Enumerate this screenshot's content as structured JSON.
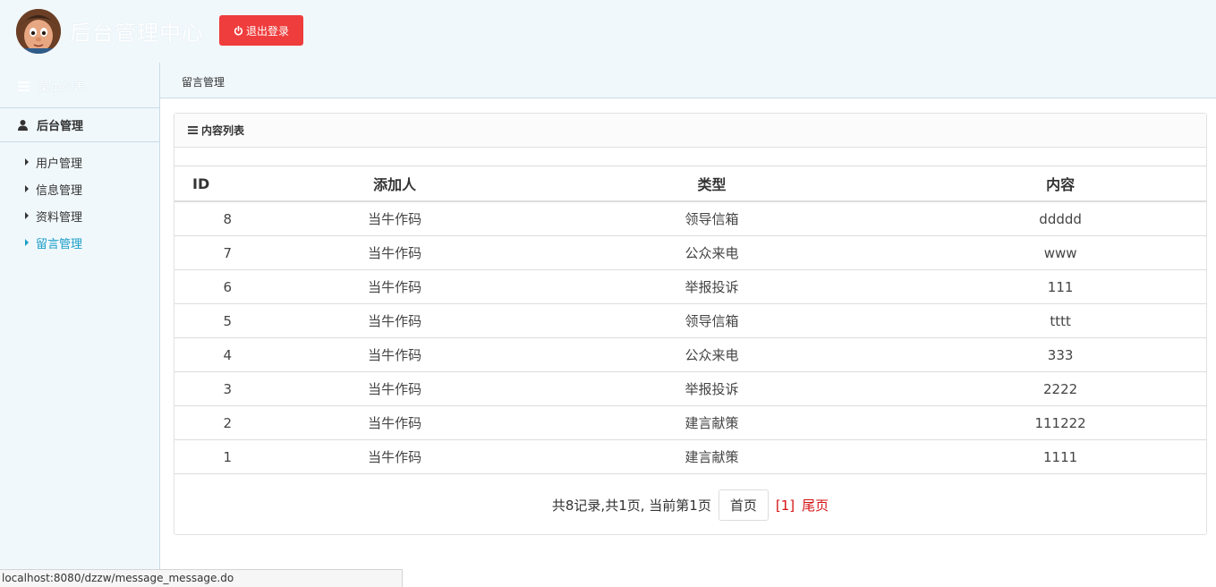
{
  "header": {
    "title": "后台管理中心",
    "logout_label": "退出登录"
  },
  "sidebar": {
    "menu_title": "菜单列表",
    "group_title": "后台管理",
    "items": [
      {
        "label": "用户管理",
        "active": false
      },
      {
        "label": "信息管理",
        "active": false
      },
      {
        "label": "资料管理",
        "active": false
      },
      {
        "label": "留言管理",
        "active": true
      }
    ]
  },
  "breadcrumb": "留言管理",
  "panel": {
    "title": "内容列表"
  },
  "table": {
    "headers": [
      "ID",
      "添加人",
      "类型",
      "内容"
    ],
    "rows": [
      [
        "8",
        "当牛作码",
        "领导信箱",
        "ddddd"
      ],
      [
        "7",
        "当牛作码",
        "公众来电",
        "www"
      ],
      [
        "6",
        "当牛作码",
        "举报投诉",
        "111"
      ],
      [
        "5",
        "当牛作码",
        "领导信箱",
        "tttt"
      ],
      [
        "4",
        "当牛作码",
        "公众来电",
        "333"
      ],
      [
        "3",
        "当牛作码",
        "举报投诉",
        "2222"
      ],
      [
        "2",
        "当牛作码",
        "建言献策",
        "111222"
      ],
      [
        "1",
        "当牛作码",
        "建言献策",
        "1111"
      ]
    ]
  },
  "pager": {
    "summary": "共8记录,共1页, 当前第1页",
    "first_label": "首页",
    "current_label": "[1]",
    "last_label": "尾页"
  },
  "status_url": "localhost:8080/dzzw/message_message.do",
  "colors": {
    "accent": "#1a9dc7",
    "logout_bg": "#ef3c3c",
    "pager_link": "#d41414",
    "sidebar_bg": "#f1f8fc"
  }
}
